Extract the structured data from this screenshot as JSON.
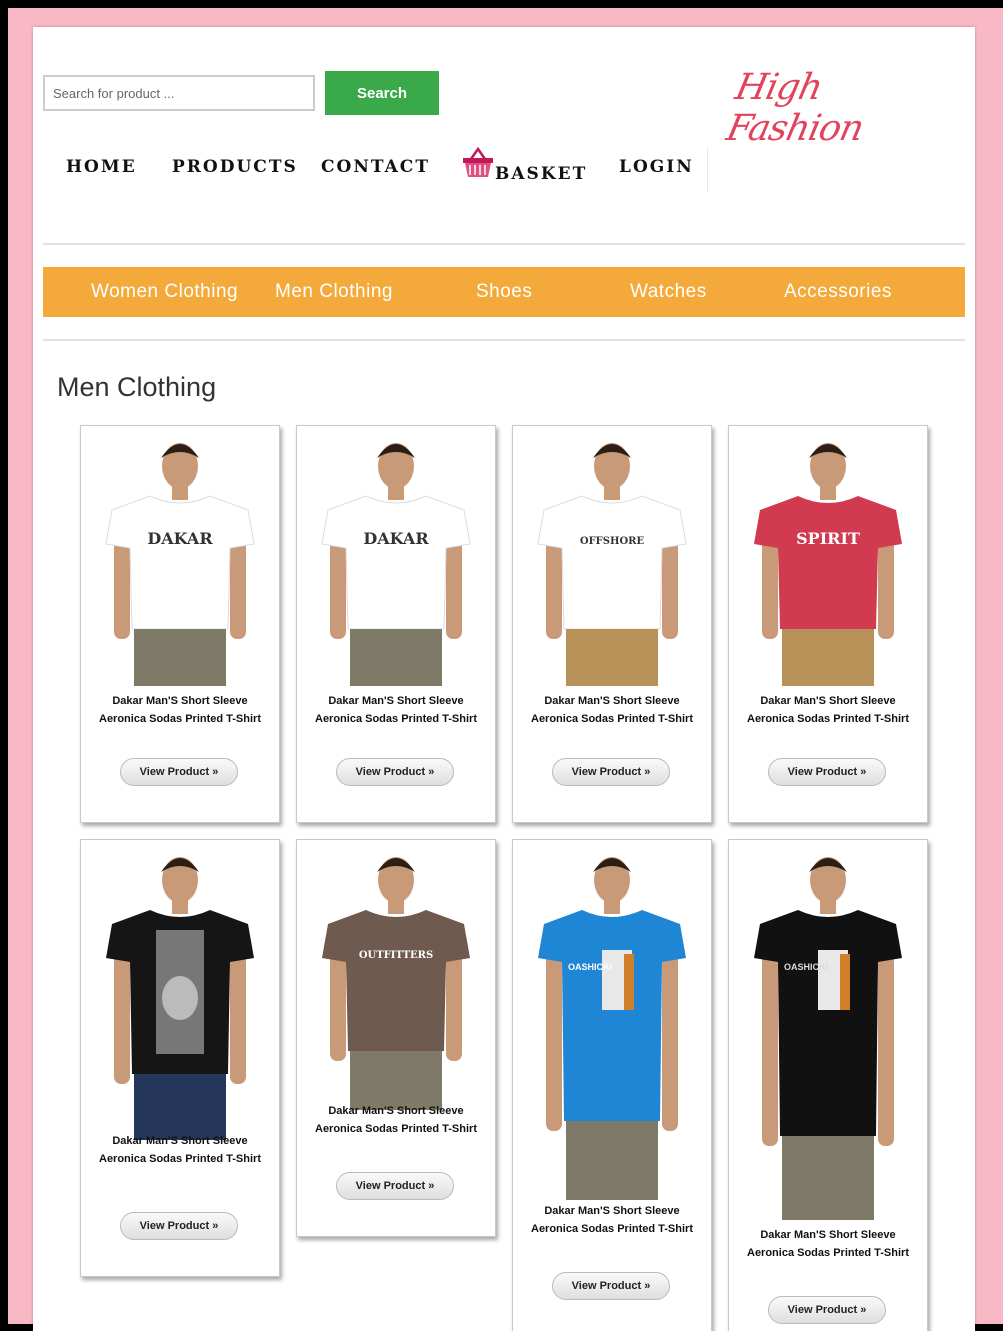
{
  "header": {
    "search_placeholder": "Search for product ...",
    "search_button": "Search",
    "logo_text": "High Fashion"
  },
  "nav": {
    "home": "HOME",
    "products": "PRODUCTS",
    "contact": "CONTACT",
    "basket": "BASKET",
    "login": "LOGIN"
  },
  "categories": [
    "Women Clothing",
    "Men Clothing",
    "Shoes",
    "Watches",
    "Accessories"
  ],
  "section_title": "Men Clothing",
  "products": [
    {
      "title_line1": "Dakar Man'S Short Sleeve",
      "title_line2": "Aeronica Sodas Printed T-Shirt",
      "button": "View Product »",
      "shirt_color": "#ffffff",
      "graphic": "DAKAR"
    },
    {
      "title_line1": "Dakar Man'S Short Sleeve",
      "title_line2": "Aeronica Sodas Printed T-Shirt",
      "button": "View Product »",
      "shirt_color": "#ffffff",
      "graphic": "DAKAR"
    },
    {
      "title_line1": "Dakar Man'S Short Sleeve",
      "title_line2": "Aeronica Sodas Printed T-Shirt",
      "button": "View Product »",
      "shirt_color": "#ffffff",
      "graphic": "OFFSHORE"
    },
    {
      "title_line1": "Dakar Man'S Short Sleeve",
      "title_line2": "Aeronica Sodas Printed T-Shirt",
      "button": "View Product »",
      "shirt_color": "#d23b4f",
      "graphic": "SPIRIT"
    },
    {
      "title_line1": "Dakar Man'S Short Sleeve",
      "title_line2": "Aeronica Sodas Printed T-Shirt",
      "button": "View Product »",
      "shirt_color": "#151515",
      "graphic": "SKULL"
    },
    {
      "title_line1": "Dakar Man'S Short Sleeve",
      "title_line2": "Aeronica Sodas Printed T-Shirt",
      "button": "View Product »",
      "shirt_color": "#6e5a4e",
      "graphic": "OUTFITTERS"
    },
    {
      "title_line1": "Dakar Man'S Short Sleeve",
      "title_line2": "Aeronica Sodas Printed T-Shirt",
      "button": "View Product »",
      "shirt_color": "#1f86d6",
      "graphic": "OASHICKI"
    },
    {
      "title_line1": "Dakar Man'S Short Sleeve",
      "title_line2": "Aeronica Sodas Printed T-Shirt",
      "button": "View Product »",
      "shirt_color": "#111111",
      "graphic": "OASHICKI"
    }
  ],
  "colors": {
    "frame": "#f9b8c5",
    "category_bar": "#f4aa3b",
    "search_button": "#3aa94a",
    "logo": "#e3435a"
  }
}
